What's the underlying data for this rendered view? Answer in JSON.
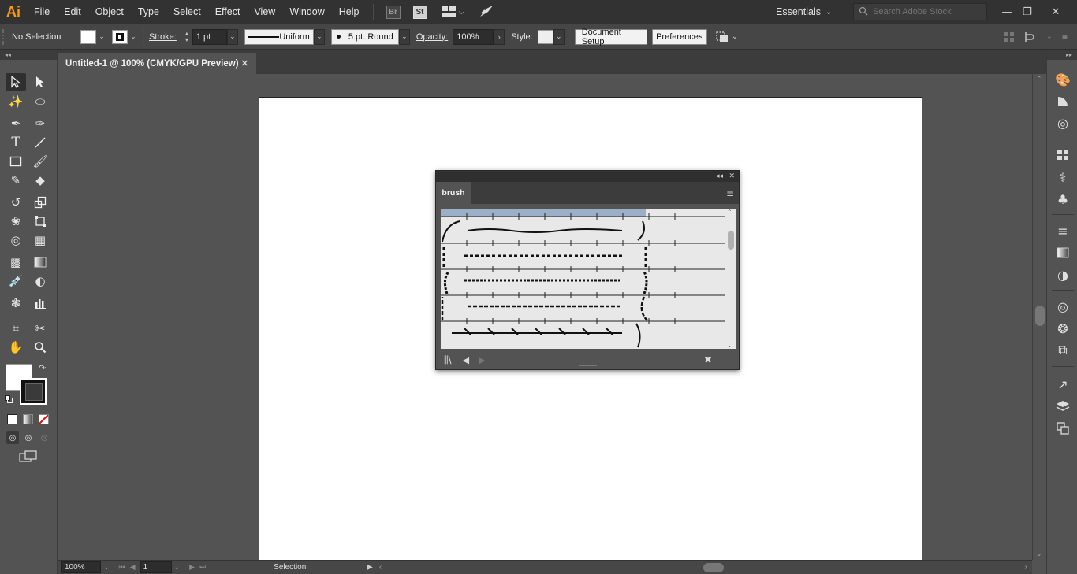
{
  "app": {
    "logo_text": "Ai",
    "menu": [
      "File",
      "Edit",
      "Object",
      "Type",
      "Select",
      "Effect",
      "View",
      "Window",
      "Help"
    ],
    "bridge_label": "Br",
    "stock_label": "St",
    "workspace": "Essentials",
    "search_placeholder": "Search Adobe Stock"
  },
  "control_bar": {
    "selection_state": "No Selection",
    "stroke_label": "Stroke:",
    "stroke_weight": "1 pt",
    "profile": "Uniform",
    "brush_definition": "5 pt. Round",
    "opacity_label": "Opacity:",
    "opacity_value": "100%",
    "style_label": "Style:",
    "document_setup_label": "Document Setup",
    "preferences_label": "Preferences"
  },
  "document": {
    "tab_title": "Untitled-1 @ 100% (CMYK/GPU Preview)"
  },
  "brush_panel": {
    "tab_label": "brush"
  },
  "status_bar": {
    "zoom": "100%",
    "artboard_number": "1",
    "status_text": "Selection"
  },
  "colors": {
    "accent_logo": "#ff9a00",
    "app_bg": "#535353",
    "menubar_bg": "#323232"
  }
}
